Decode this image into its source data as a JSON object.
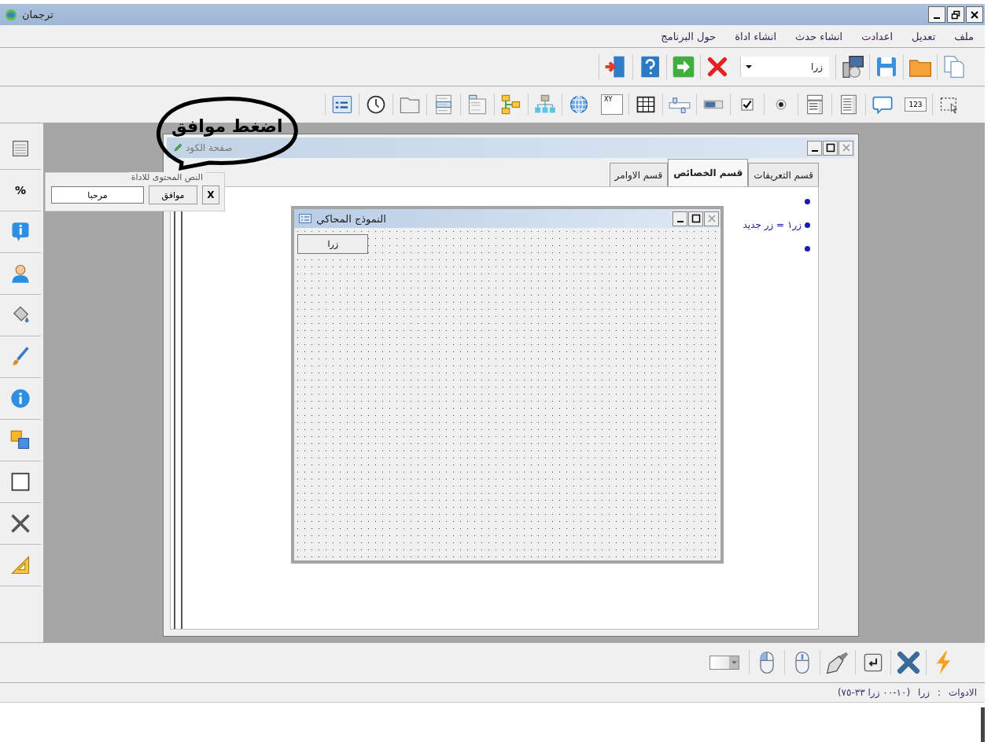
{
  "window": {
    "title": "ترجمان"
  },
  "menu": [
    "ملف",
    "تعديل",
    "اعدادت",
    "انشاء حدث",
    "انشاء اداة",
    "حول البرنامج"
  ],
  "toolbar": {
    "control_combo": {
      "value": "زرا"
    }
  },
  "tools_toolbar": {
    "number_label": "123",
    "xy_label": "XY"
  },
  "side_toolbar": {
    "percent_label": "%"
  },
  "code_window": {
    "title": "صفحة الكود",
    "tabs": [
      {
        "label": "قسم التعريفات",
        "selected": false
      },
      {
        "label": "قسم الخصائص",
        "selected": true
      },
      {
        "label": "قسم الاوامر",
        "selected": false
      }
    ],
    "lines": [
      {
        "kind": "blank"
      },
      {
        "kind": "code",
        "text": "زر١ = زر جديد"
      },
      {
        "kind": "blank"
      }
    ]
  },
  "form_window": {
    "title": "النموذج المحاكي",
    "button": "زرا"
  },
  "text_panel": {
    "legend": "النص المحتوى للاداة",
    "value": "مرحبا",
    "ok": "موافق",
    "close": "X"
  },
  "callout": {
    "text": "اضغط موافق"
  },
  "status_bar": {
    "label": "الادوات",
    "separator": ":",
    "control": "زرا",
    "position": "(١٠-٠٠ زرا ٣٣-٧٥)"
  }
}
